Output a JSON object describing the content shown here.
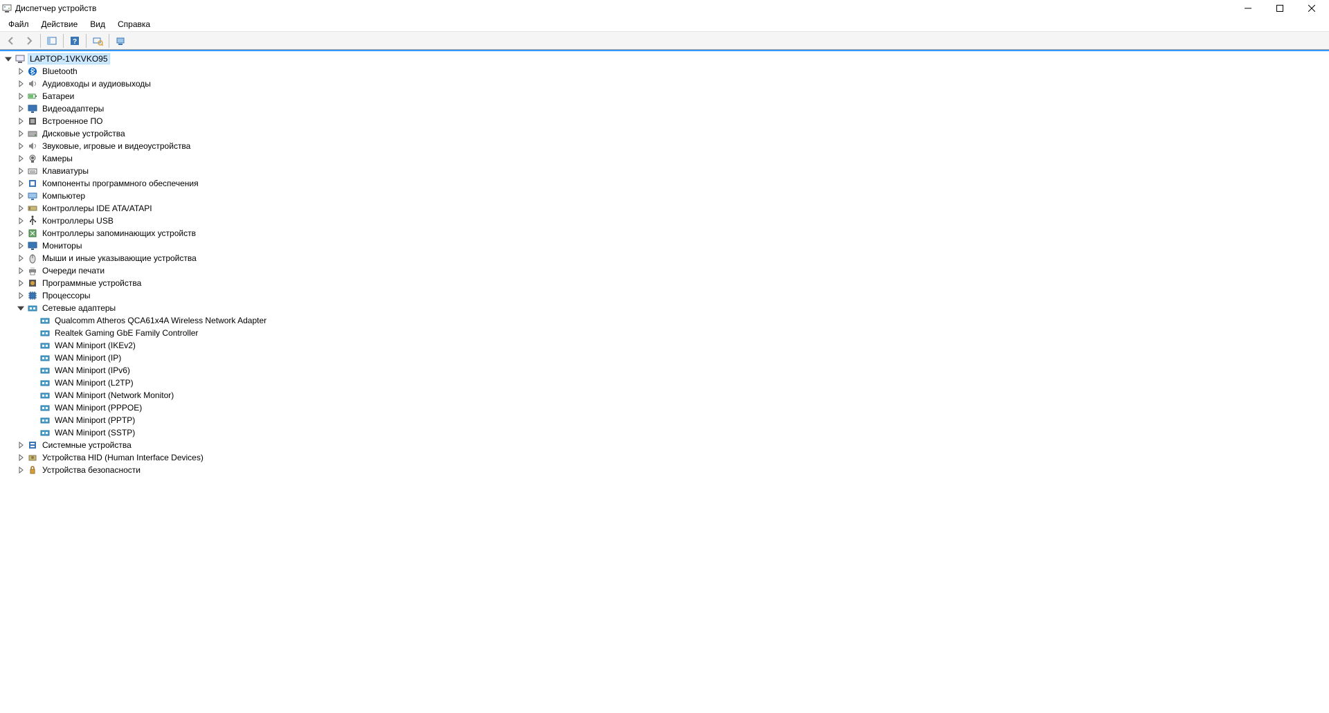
{
  "window": {
    "title": "Диспетчер устройств"
  },
  "menu": {
    "file": "Файл",
    "action": "Действие",
    "view": "Вид",
    "help": "Справка"
  },
  "tree": {
    "root": "LAPTOP-1VKVKO95",
    "categories": [
      {
        "label": "Bluetooth",
        "icon": "bluetooth"
      },
      {
        "label": "Аудиовходы и аудиовыходы",
        "icon": "audio"
      },
      {
        "label": "Батареи",
        "icon": "battery"
      },
      {
        "label": "Видеоадаптеры",
        "icon": "display"
      },
      {
        "label": "Встроенное ПО",
        "icon": "firmware"
      },
      {
        "label": "Дисковые устройства",
        "icon": "disk"
      },
      {
        "label": "Звуковые, игровые и видеоустройства",
        "icon": "sound"
      },
      {
        "label": "Камеры",
        "icon": "camera"
      },
      {
        "label": "Клавиатуры",
        "icon": "keyboard"
      },
      {
        "label": "Компоненты программного обеспечения",
        "icon": "software"
      },
      {
        "label": "Компьютер",
        "icon": "computer"
      },
      {
        "label": "Контроллеры IDE ATA/ATAPI",
        "icon": "ide"
      },
      {
        "label": "Контроллеры USB",
        "icon": "usb"
      },
      {
        "label": "Контроллеры запоминающих устройств",
        "icon": "storage"
      },
      {
        "label": "Мониторы",
        "icon": "monitor"
      },
      {
        "label": "Мыши и иные указывающие устройства",
        "icon": "mouse"
      },
      {
        "label": "Очереди печати",
        "icon": "printer"
      },
      {
        "label": "Программные устройства",
        "icon": "softdev"
      },
      {
        "label": "Процессоры",
        "icon": "cpu"
      },
      {
        "label": "Сетевые адаптеры",
        "icon": "network",
        "expanded": true,
        "children": [
          "Qualcomm Atheros QCA61x4A Wireless Network Adapter",
          "Realtek Gaming GbE Family Controller",
          "WAN Miniport (IKEv2)",
          "WAN Miniport (IP)",
          "WAN Miniport (IPv6)",
          "WAN Miniport (L2TP)",
          "WAN Miniport (Network Monitor)",
          "WAN Miniport (PPPOE)",
          "WAN Miniport (PPTP)",
          "WAN Miniport (SSTP)"
        ]
      },
      {
        "label": "Системные устройства",
        "icon": "system"
      },
      {
        "label": "Устройства HID (Human Interface Devices)",
        "icon": "hid"
      },
      {
        "label": "Устройства безопасности",
        "icon": "security"
      }
    ]
  }
}
